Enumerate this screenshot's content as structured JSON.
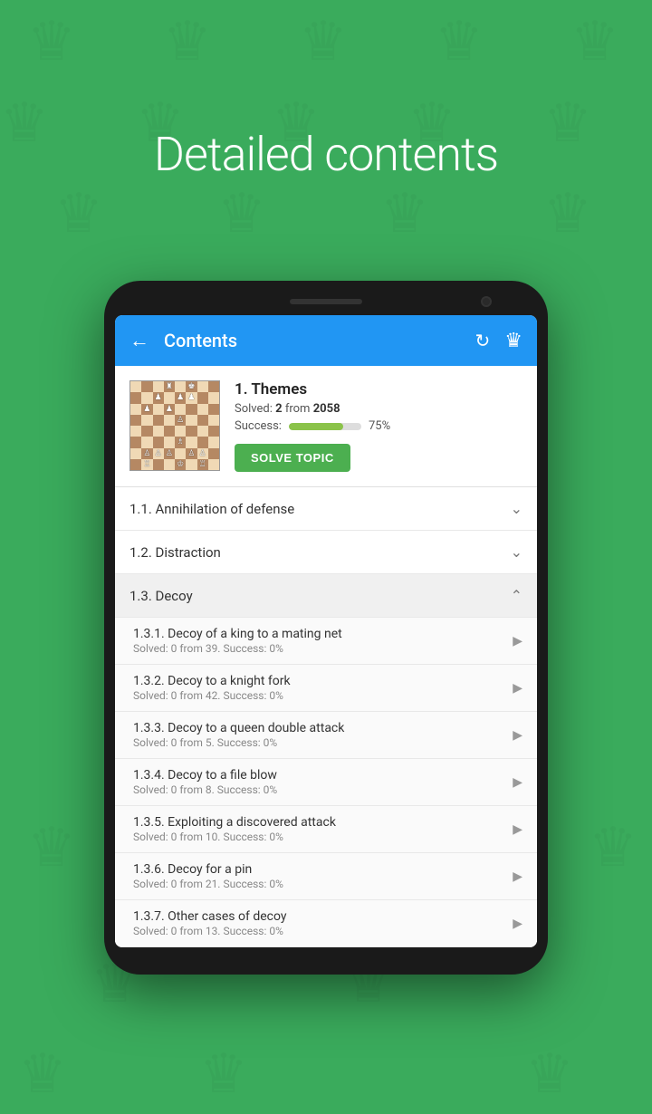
{
  "page": {
    "title": "Detailed contents",
    "background_color": "#3aab5c"
  },
  "app_bar": {
    "title": "Contents",
    "back_label": "←",
    "refresh_icon": "refresh",
    "crown_icon": "♛"
  },
  "topic_card": {
    "title": "1. Themes",
    "solved_label": "Solved:",
    "solved_count": "2",
    "solved_from": "from",
    "total_count": "2058",
    "success_label": "Success:",
    "progress_percent": 75,
    "progress_percent_label": "75%",
    "solve_button_label": "SOLVE TOPIC"
  },
  "sections": [
    {
      "id": "1.1",
      "title": "1.1. Annihilation of defense",
      "expanded": false,
      "children": []
    },
    {
      "id": "1.2",
      "title": "1.2. Distraction",
      "expanded": false,
      "children": []
    },
    {
      "id": "1.3",
      "title": "1.3. Decoy",
      "expanded": true,
      "children": [
        {
          "title": "1.3.1. Decoy of a king to a mating net",
          "subtitle": "Solved: 0 from 39. Success: 0%"
        },
        {
          "title": "1.3.2. Decoy to a knight fork",
          "subtitle": "Solved: 0 from 42. Success: 0%"
        },
        {
          "title": "1.3.3. Decoy to a queen double attack",
          "subtitle": "Solved: 0 from 5. Success: 0%"
        },
        {
          "title": "1.3.4. Decoy to a file blow",
          "subtitle": "Solved: 0 from 8. Success: 0%"
        },
        {
          "title": "1.3.5. Exploiting a discovered attack",
          "subtitle": "Solved: 0 from 10. Success: 0%"
        },
        {
          "title": "1.3.6. Decoy for a pin",
          "subtitle": "Solved: 0 from 21. Success: 0%"
        },
        {
          "title": "1.3.7. Other cases of decoy",
          "subtitle": "Solved: 0 from 13. Success: 0%"
        }
      ]
    }
  ],
  "icons": {
    "back": "←",
    "chevron_down": "⌄",
    "chevron_up": "⌃",
    "play": "▶",
    "refresh": "↻",
    "crown": "♛"
  }
}
